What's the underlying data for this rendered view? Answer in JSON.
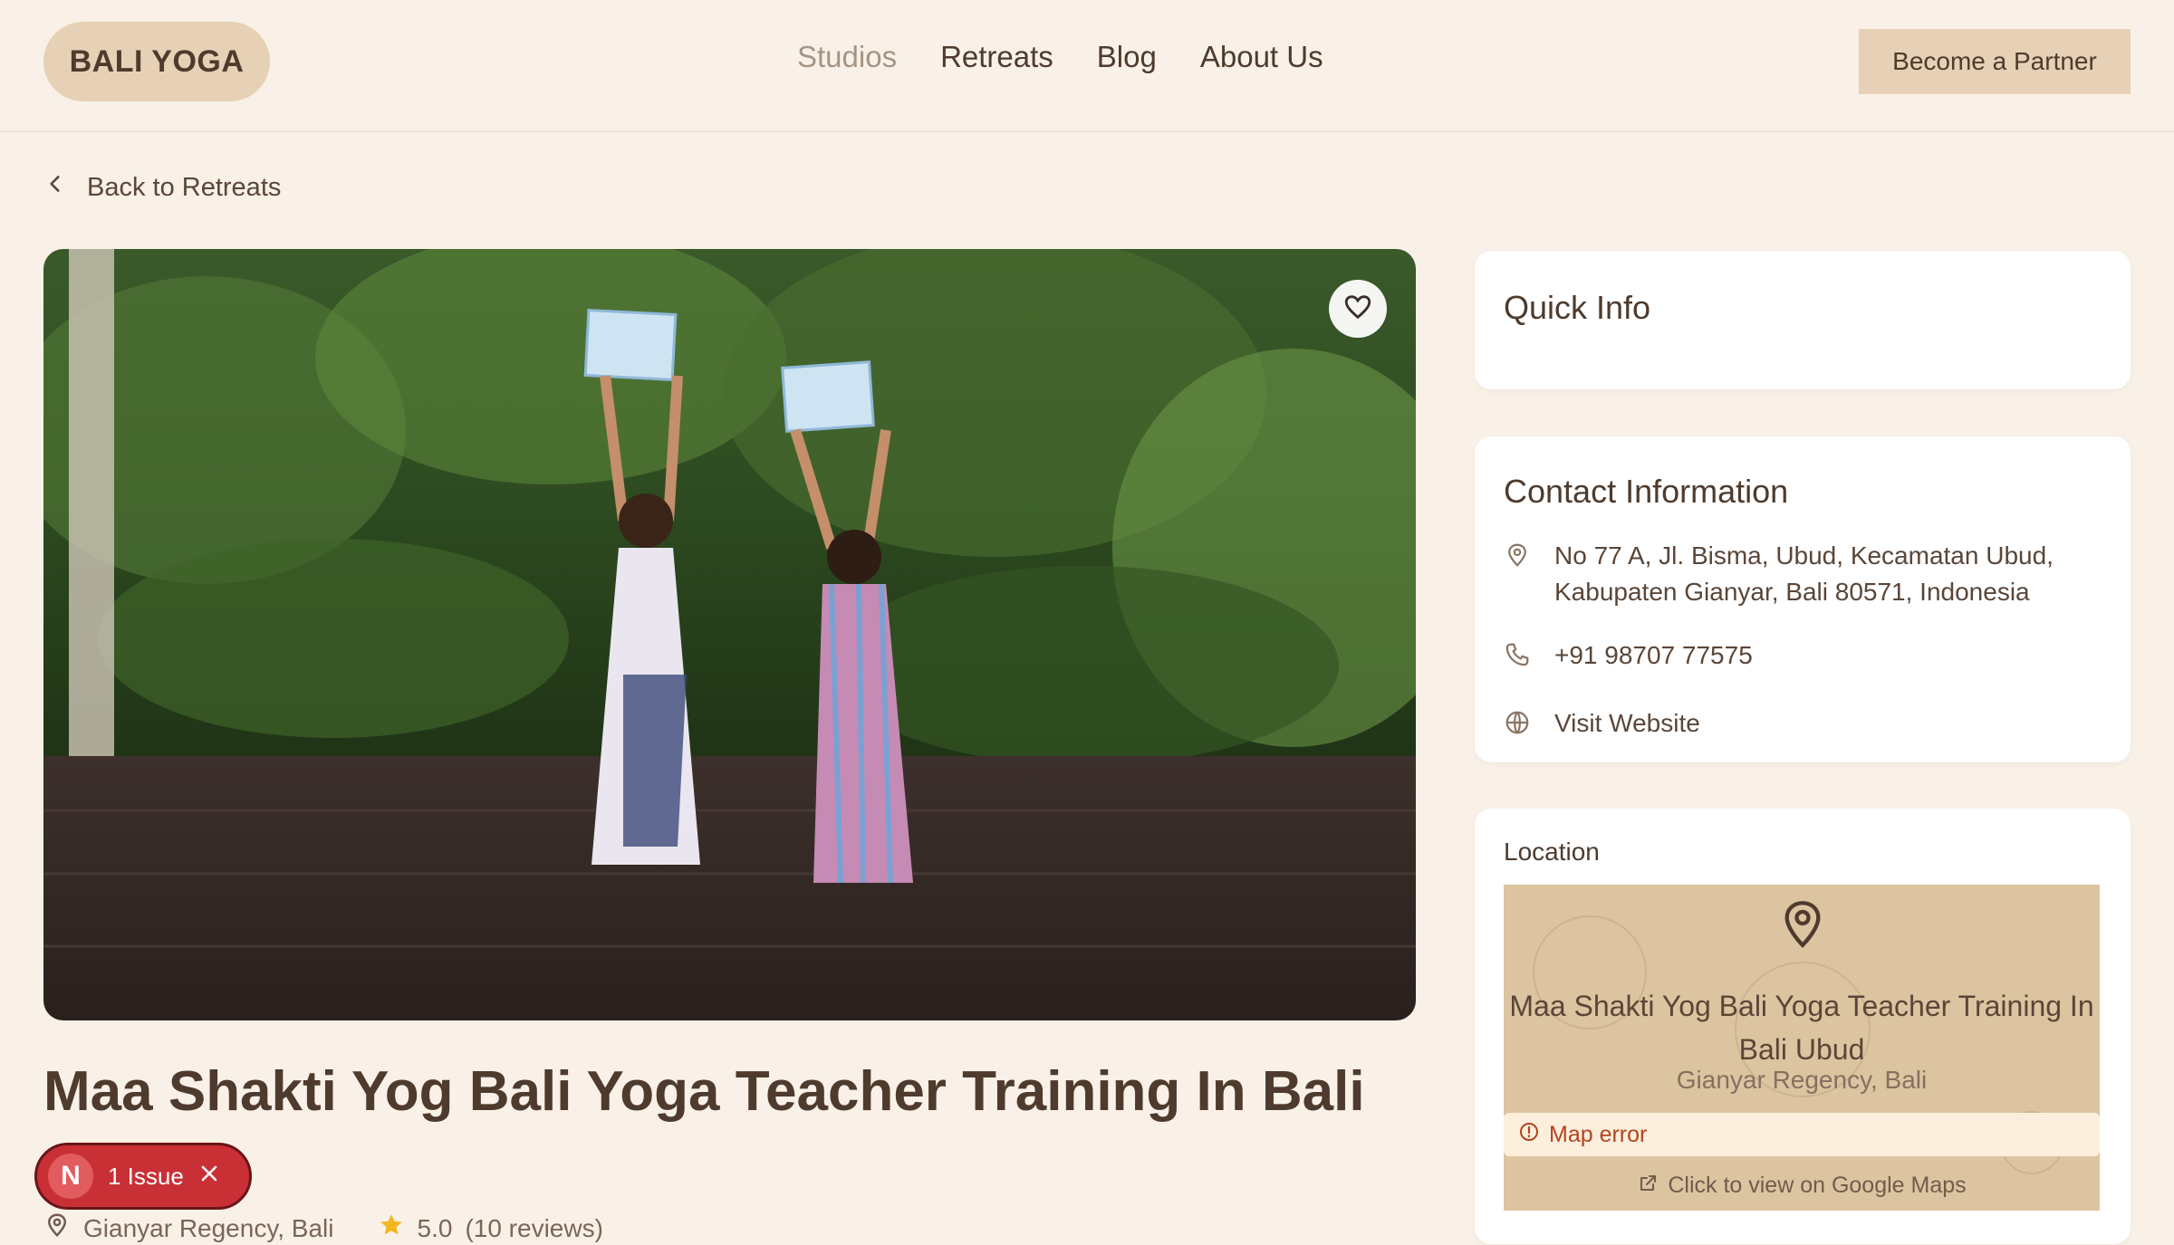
{
  "header": {
    "logo": "BALI YOGA",
    "nav": [
      "Studios",
      "Retreats",
      "Blog",
      "About Us"
    ],
    "partner_button": "Become a Partner"
  },
  "back_link": "Back to Retreats",
  "retreat": {
    "title": "Maa Shakti Yog Bali Yoga Teacher Training In Bali",
    "location": "Gianyar Regency, Bali",
    "rating": "5.0",
    "reviews": "(10 reviews)"
  },
  "issue_badge": {
    "letter": "N",
    "label": "1 Issue"
  },
  "quick_info": {
    "heading": "Quick Info"
  },
  "contact": {
    "heading": "Contact Information",
    "address": "No 77 A, Jl. Bisma, Ubud, Kecamatan Ubud, Kabupaten Gianyar, Bali 80571, Indonesia",
    "phone": "+91 98707 77575",
    "website": "Visit Website"
  },
  "location_card": {
    "label": "Location",
    "map_title": "Maa Shakti Yog Bali Yoga Teacher Training In Bali Ubud",
    "map_subtitle": "Gianyar Regency, Bali",
    "map_error": "Map error",
    "map_link": "Click to view on Google Maps"
  },
  "colors": {
    "accent": "#e6d1b6",
    "background": "#f9f1e7",
    "error": "#b4431e"
  }
}
